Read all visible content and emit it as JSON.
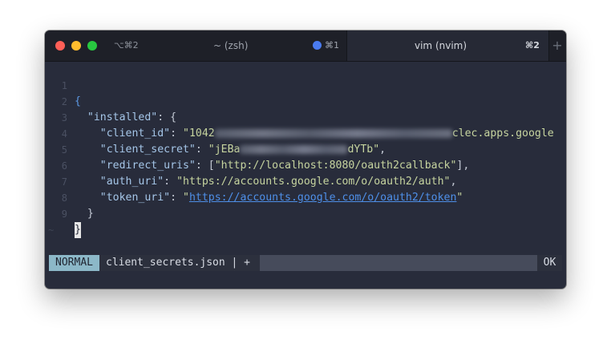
{
  "tabs": [
    {
      "shortcut_left": "⌥⌘2",
      "title": "~ (zsh)",
      "shortcut_right": "⌘1"
    },
    {
      "title": "vim (nvim)",
      "shortcut_right": "⌘2"
    }
  ],
  "new_tab_label": "+",
  "editor": {
    "line_numbers": [
      "1",
      "2",
      "3",
      "4",
      "5",
      "6",
      "7",
      "8",
      "9"
    ],
    "open_brace": "{",
    "installed_key": "\"installed\"",
    "installed_sep": ": {",
    "client_id_key": "\"client_id\"",
    "client_id_prefix": "\"1042",
    "client_id_suffix": "clec.apps.google",
    "client_secret_key": "\"client_secret\"",
    "client_secret_prefix": "\"jEBa",
    "client_secret_suffix": "dYTb\"",
    "redirect_uris_key": "\"redirect_uris\"",
    "redirect_uris_value": "\"http://localhost:8080/oauth2callback\"",
    "auth_uri_key": "\"auth_uri\"",
    "auth_uri_value": "\"https://accounts.google.com/o/oauth2/auth\"",
    "token_uri_key": "\"token_uri\"",
    "token_uri_link": "https://accounts.google.com/o/oauth2/token",
    "inner_close": "}",
    "outer_close": "}",
    "empty_line_marker": "~"
  },
  "statusline": {
    "mode": "NORMAL",
    "filename": "client_secrets.json | +",
    "right": "OK"
  },
  "colors": {
    "background": "#282c3b",
    "mode_bg": "#8cb8c8",
    "traffic_red": "#fe5f57",
    "traffic_yellow": "#febc2e",
    "traffic_green": "#28c840",
    "activity_dot": "#4a7bf0"
  }
}
